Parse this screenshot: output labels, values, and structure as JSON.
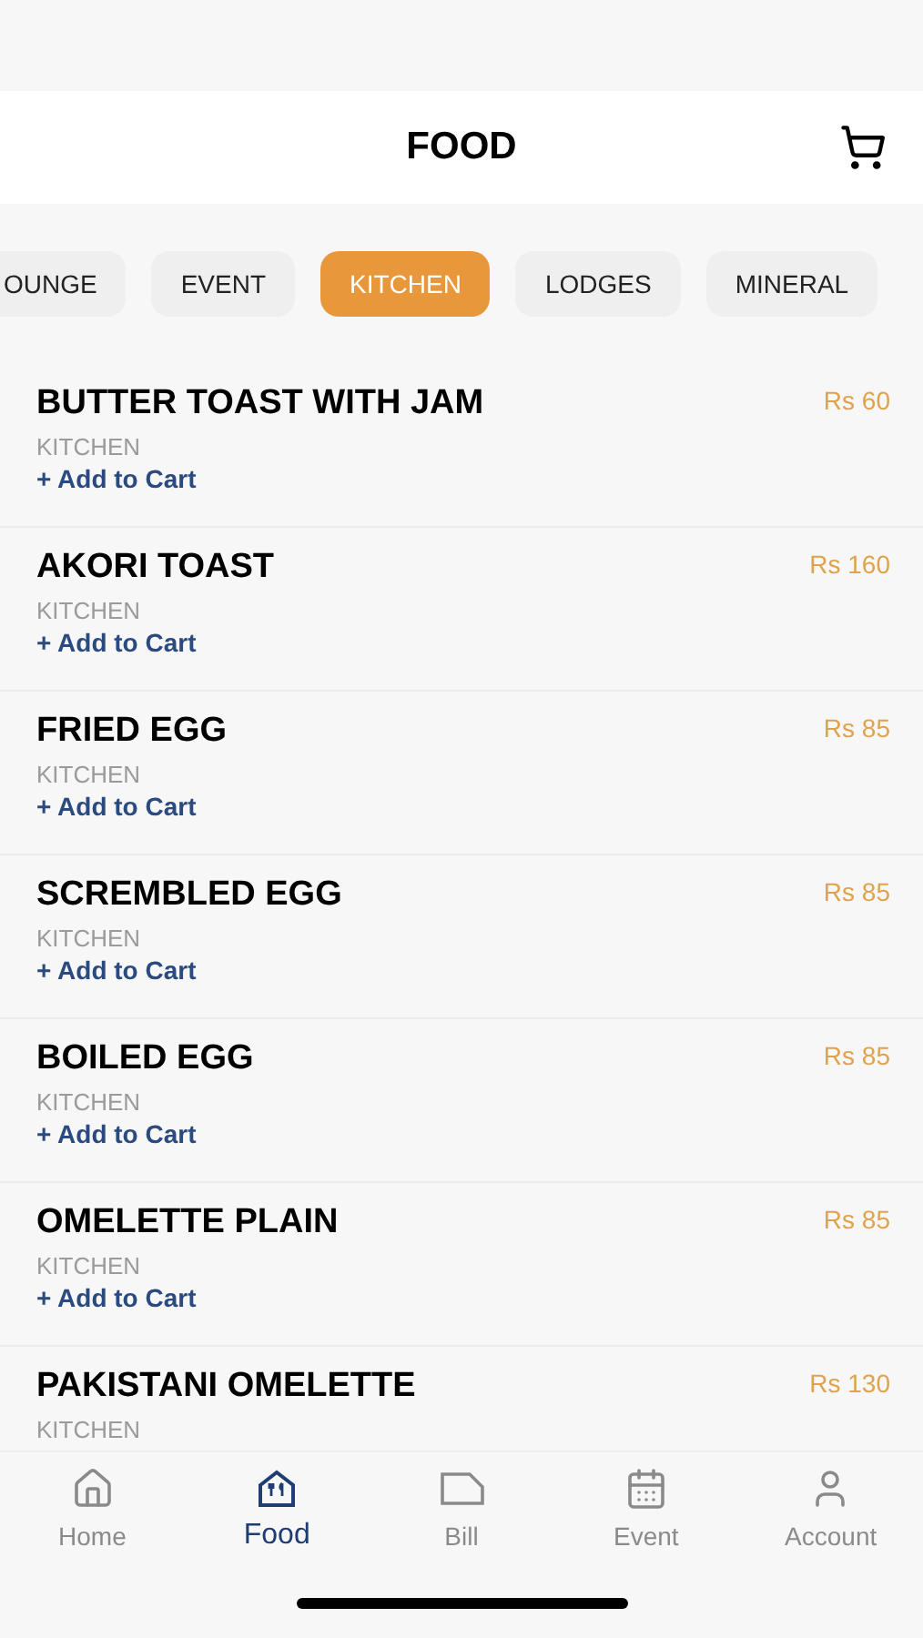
{
  "header": {
    "title": "FOOD"
  },
  "categories": [
    {
      "label": "OUNGE",
      "selected": false
    },
    {
      "label": "EVENT",
      "selected": false
    },
    {
      "label": "KITCHEN",
      "selected": true
    },
    {
      "label": "LODGES",
      "selected": false
    },
    {
      "label": "MINERAL",
      "selected": false
    }
  ],
  "items": [
    {
      "name": "BUTTER TOAST WITH JAM",
      "price": "Rs 60",
      "category": "KITCHEN",
      "action": "+ Add to Cart"
    },
    {
      "name": "AKORI TOAST",
      "price": "Rs 160",
      "category": "KITCHEN",
      "action": "+ Add to Cart"
    },
    {
      "name": "FRIED EGG",
      "price": "Rs 85",
      "category": "KITCHEN",
      "action": "+ Add to Cart"
    },
    {
      "name": "SCREMBLED EGG",
      "price": "Rs 85",
      "category": "KITCHEN",
      "action": "+ Add to Cart"
    },
    {
      "name": "BOILED EGG",
      "price": "Rs 85",
      "category": "KITCHEN",
      "action": "+ Add to Cart"
    },
    {
      "name": "OMELETTE PLAIN",
      "price": "Rs 85",
      "category": "KITCHEN",
      "action": "+ Add to Cart"
    },
    {
      "name": "PAKISTANI OMELETTE",
      "price": "Rs 130",
      "category": "KITCHEN"
    }
  ],
  "nav": [
    {
      "label": "Home",
      "kind": "home",
      "selected": false
    },
    {
      "label": "Food",
      "kind": "food",
      "selected": true
    },
    {
      "label": "Bill",
      "kind": "bill",
      "selected": false
    },
    {
      "label": "Event",
      "kind": "event",
      "selected": false
    },
    {
      "label": "Account",
      "kind": "account",
      "selected": false
    }
  ]
}
